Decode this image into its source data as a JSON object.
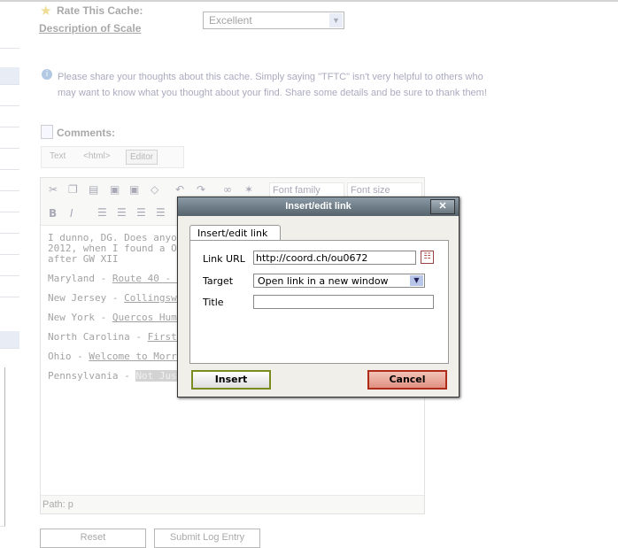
{
  "rating": {
    "label": "Rate This Cache:",
    "scale_link": "Description of Scale",
    "value": "Excellent",
    "icon": "star-icon"
  },
  "info_text": "Please share your thoughts about this cache. Simply saying \"TFTC\" isn't very helpful to others who may want to know what you thought about your find. Share some details and be sure to thank them!",
  "comments_label": "Comments:",
  "modes": [
    "Text",
    "<html>",
    "Editor"
  ],
  "toolbar": {
    "font_family": "Font family",
    "font_size": "Font size"
  },
  "content": {
    "intro": "I dunno, DG. Does anyone Gator? I actually didn't find until 2012, when I found a Ohio. I'm now up to 7 U.S. West Virginia after GW XII",
    "lines": [
      {
        "state": "Maryland - ",
        "link": "Route 40 - Tow"
      },
      {
        "state": "New Jersey - ",
        "link": "Collingswood"
      },
      {
        "state": "New York - ",
        "link": "Quercos Humor"
      },
      {
        "state": "North Carolina - ",
        "link": "First in Fli"
      },
      {
        "state": "Ohio - ",
        "link": "Welcome to Morrow"
      },
      {
        "state": "Pennsylvania - ",
        "link": "Not Just Another Cache Name"
      }
    ]
  },
  "path": "Path: p",
  "buttons": {
    "reset": "Reset",
    "submit": "Submit Log Entry"
  },
  "dialog": {
    "title": "Insert/edit link",
    "tab": "Insert/edit link",
    "url_label": "Link URL",
    "url_value": "http://coord.ch/ou0672",
    "target_label": "Target",
    "target_value": "Open link in a new window",
    "title_label": "Title",
    "title_value": "",
    "insert": "Insert",
    "cancel": "Cancel"
  }
}
